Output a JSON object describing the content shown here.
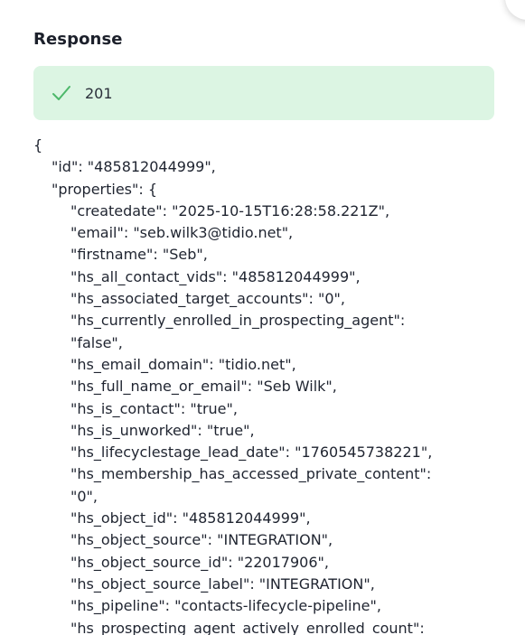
{
  "response": {
    "title": "Response",
    "status_code": "201",
    "status_icon": "check-icon",
    "status_color": "#4cb86a",
    "status_bg": "#dcf5e3"
  },
  "json_lines": [
    {
      "text": "{",
      "indent": 0
    },
    {
      "text": "\"id\": \"485812044999\",",
      "indent": 1
    },
    {
      "text": "\"properties\": {",
      "indent": 1
    },
    {
      "text": "\"createdate\": \"2025-10-15T16:28:58.221Z\",",
      "indent": 2
    },
    {
      "text": "\"email\": \"seb.wilk3@tidio.net\",",
      "indent": 2
    },
    {
      "text": "\"firstname\": \"Seb\",",
      "indent": 2
    },
    {
      "text": "\"hs_all_contact_vids\": \"485812044999\",",
      "indent": 2
    },
    {
      "text": "\"hs_associated_target_accounts\": \"0\",",
      "indent": 2
    },
    {
      "text": "\"hs_currently_enrolled_in_prospecting_agent\":",
      "indent": 2
    },
    {
      "text": "\"false\",",
      "indent": 2
    },
    {
      "text": "\"hs_email_domain\": \"tidio.net\",",
      "indent": 2
    },
    {
      "text": "\"hs_full_name_or_email\": \"Seb Wilk\",",
      "indent": 2
    },
    {
      "text": "\"hs_is_contact\": \"true\",",
      "indent": 2
    },
    {
      "text": "\"hs_is_unworked\": \"true\",",
      "indent": 2
    },
    {
      "text": "\"hs_lifecyclestage_lead_date\": \"1760545738221\",",
      "indent": 2
    },
    {
      "text": "\"hs_membership_has_accessed_private_content\":",
      "indent": 2
    },
    {
      "text": "\"0\",",
      "indent": 2
    },
    {
      "text": "\"hs_object_id\": \"485812044999\",",
      "indent": 2
    },
    {
      "text": "\"hs_object_source\": \"INTEGRATION\",",
      "indent": 2
    },
    {
      "text": "\"hs_object_source_id\": \"22017906\",",
      "indent": 2
    },
    {
      "text": "\"hs_object_source_label\": \"INTEGRATION\",",
      "indent": 2
    },
    {
      "text": "\"hs_pipeline\": \"contacts-lifecycle-pipeline\",",
      "indent": 2
    },
    {
      "text": "\"hs_prospecting_agent_actively_enrolled_count\":",
      "indent": 2
    }
  ]
}
